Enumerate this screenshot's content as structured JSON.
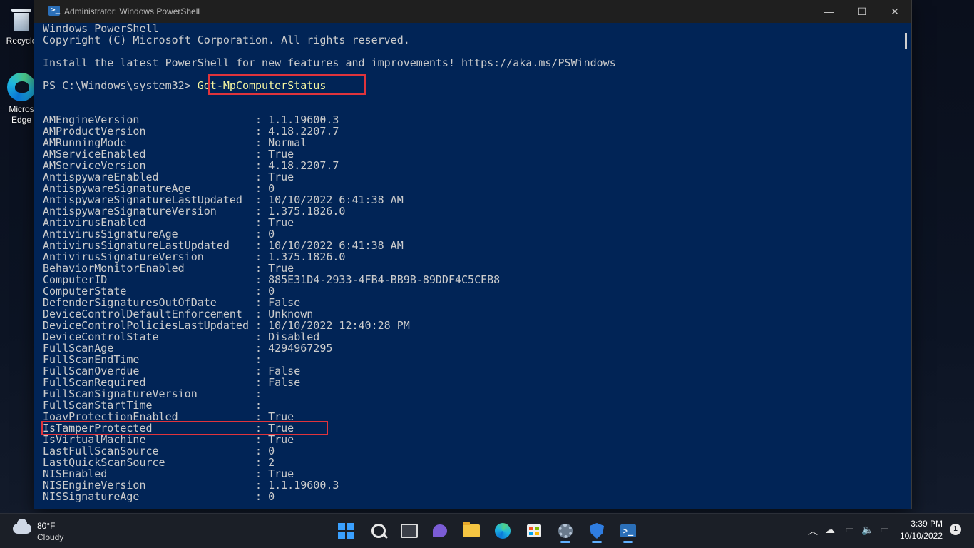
{
  "desktop": {
    "icons": [
      {
        "label": "Recycle"
      },
      {
        "label": "Micros\nEdge"
      }
    ]
  },
  "window": {
    "title": "Administrator: Windows PowerShell",
    "controls": {
      "minimize": "—",
      "maximize": "☐",
      "close": "✕"
    }
  },
  "console": {
    "header_lines": [
      "Windows PowerShell",
      "Copyright (C) Microsoft Corporation. All rights reserved.",
      "",
      "Install the latest PowerShell for new features and improvements! https://aka.ms/PSWindows"
    ],
    "prompt": "PS C:\\Windows\\system32> ",
    "command": "Get-MpComputerStatus",
    "output": [
      {
        "key": "AMEngineVersion",
        "value": "1.1.19600.3"
      },
      {
        "key": "AMProductVersion",
        "value": "4.18.2207.7"
      },
      {
        "key": "AMRunningMode",
        "value": "Normal"
      },
      {
        "key": "AMServiceEnabled",
        "value": "True"
      },
      {
        "key": "AMServiceVersion",
        "value": "4.18.2207.7"
      },
      {
        "key": "AntispywareEnabled",
        "value": "True"
      },
      {
        "key": "AntispywareSignatureAge",
        "value": "0"
      },
      {
        "key": "AntispywareSignatureLastUpdated",
        "value": "10/10/2022 6:41:38 AM"
      },
      {
        "key": "AntispywareSignatureVersion",
        "value": "1.375.1826.0"
      },
      {
        "key": "AntivirusEnabled",
        "value": "True"
      },
      {
        "key": "AntivirusSignatureAge",
        "value": "0"
      },
      {
        "key": "AntivirusSignatureLastUpdated",
        "value": "10/10/2022 6:41:38 AM"
      },
      {
        "key": "AntivirusSignatureVersion",
        "value": "1.375.1826.0"
      },
      {
        "key": "BehaviorMonitorEnabled",
        "value": "True"
      },
      {
        "key": "ComputerID",
        "value": "885E31D4-2933-4FB4-BB9B-89DDF4C5CEB8"
      },
      {
        "key": "ComputerState",
        "value": "0"
      },
      {
        "key": "DefenderSignaturesOutOfDate",
        "value": "False"
      },
      {
        "key": "DeviceControlDefaultEnforcement",
        "value": "Unknown"
      },
      {
        "key": "DeviceControlPoliciesLastUpdated",
        "value": "10/10/2022 12:40:28 PM"
      },
      {
        "key": "DeviceControlState",
        "value": "Disabled"
      },
      {
        "key": "FullScanAge",
        "value": "4294967295"
      },
      {
        "key": "FullScanEndTime",
        "value": ""
      },
      {
        "key": "FullScanOverdue",
        "value": "False"
      },
      {
        "key": "FullScanRequired",
        "value": "False"
      },
      {
        "key": "FullScanSignatureVersion",
        "value": ""
      },
      {
        "key": "FullScanStartTime",
        "value": ""
      },
      {
        "key": "IoavProtectionEnabled",
        "value": "True"
      },
      {
        "key": "IsTamperProtected",
        "value": "True"
      },
      {
        "key": "IsVirtualMachine",
        "value": "True"
      },
      {
        "key": "LastFullScanSource",
        "value": "0"
      },
      {
        "key": "LastQuickScanSource",
        "value": "2"
      },
      {
        "key": "NISEnabled",
        "value": "True"
      },
      {
        "key": "NISEngineVersion",
        "value": "1.1.19600.3"
      },
      {
        "key": "NISSignatureAge",
        "value": "0"
      }
    ],
    "colors": {
      "background": "#012456",
      "text": "#cccccc",
      "command": "#f6f6a0",
      "highlight": "#e0343c"
    }
  },
  "taskbar": {
    "weather": {
      "temp": "80°F",
      "desc": "Cloudy"
    },
    "apps": [
      {
        "icon": "windows-start-icon",
        "active": false
      },
      {
        "icon": "search-icon",
        "active": false
      },
      {
        "icon": "task-view-icon",
        "active": false
      },
      {
        "icon": "chat-icon",
        "active": false
      },
      {
        "icon": "file-explorer-icon",
        "active": false
      },
      {
        "icon": "edge-icon",
        "active": false
      },
      {
        "icon": "store-icon",
        "active": false
      },
      {
        "icon": "settings-icon",
        "active": true
      },
      {
        "icon": "defender-shield-icon",
        "active": true
      },
      {
        "icon": "powershell-icon",
        "active": true
      }
    ],
    "tray": {
      "chevron": "︿",
      "network": "☁",
      "display": "▭",
      "volume": "🔈",
      "battery": "▭"
    },
    "clock": {
      "time": "3:39 PM",
      "date": "10/10/2022"
    },
    "notifications": "1"
  }
}
